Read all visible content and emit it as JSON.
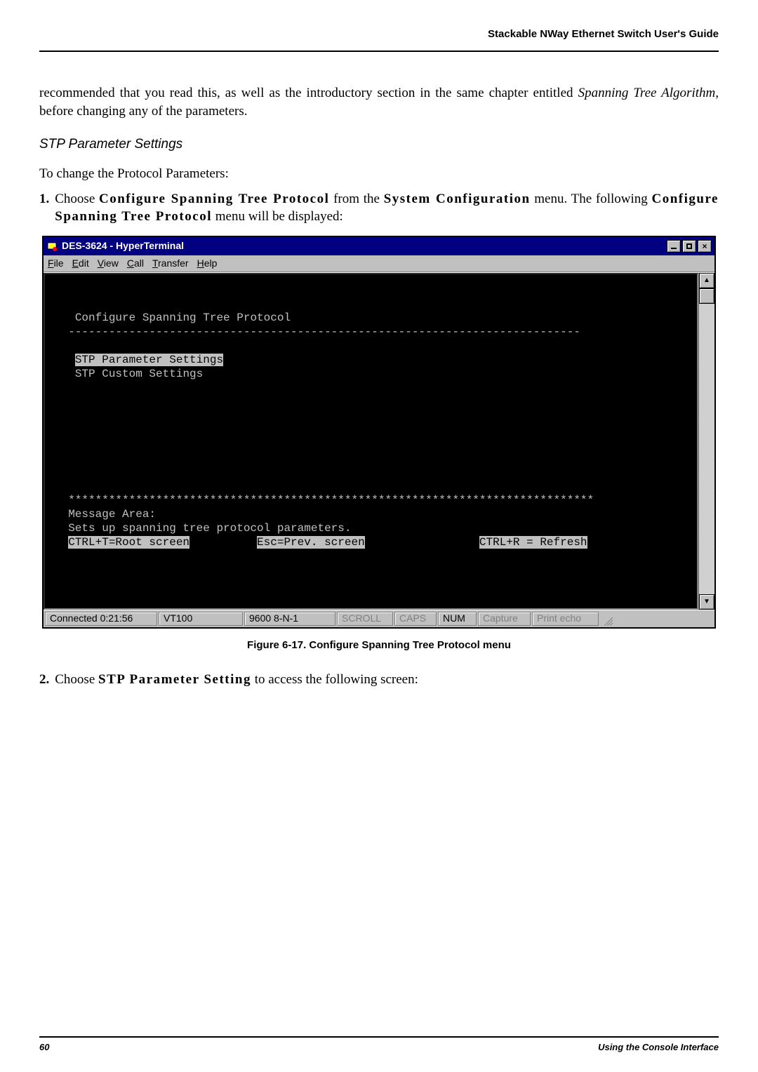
{
  "header": {
    "running_head": "Stackable NWay Ethernet Switch User's Guide"
  },
  "body": {
    "para_intro": "recommended that you read this, as well as the introductory section in the same chapter entitled ",
    "para_intro_em": "Spanning Tree Algorithm,",
    "para_intro_tail": " before changing any of the parameters.",
    "subheading": "STP Parameter Settings",
    "para_change": "To change the Protocol Parameters:",
    "step1_num": "1.",
    "step1_a": "Choose ",
    "step1_b": "Configure Spanning Tree Protocol",
    "step1_c": " from the ",
    "step1_d": "System Configuration",
    "step1_e": " menu. The following ",
    "step1_f": "Configure Spanning Tree Protocol",
    "step1_g": " menu will be displayed:",
    "step2_num": "2.",
    "step2_a": "Choose ",
    "step2_b": "STP Parameter Setting",
    "step2_c": " to access the following screen:",
    "caption": "Figure 6-17.  Configure Spanning Tree Protocol menu"
  },
  "window": {
    "title": "DES-3624 - HyperTerminal",
    "menus": {
      "file": "File",
      "edit": "Edit",
      "view": "View",
      "call": "Call",
      "transfer": "Transfer",
      "help": "Help"
    },
    "terminal": {
      "heading": "Configure Spanning Tree Protocol",
      "divider": "----------------------------------------------------------------------------",
      "item_selected": "STP Parameter Settings",
      "item2": "STP Custom Settings",
      "stars": "******************************************************************************",
      "msg_label": "Message Area:",
      "msg_text": "Sets up spanning tree protocol parameters.",
      "hint_root": "CTRL+T=Root screen",
      "hint_prev": "Esc=Prev. screen",
      "hint_refresh": "CTRL+R = Refresh"
    },
    "status": {
      "conn": "Connected 0:21:56",
      "emu": "VT100",
      "line": "9600 8-N-1",
      "scroll": "SCROLL",
      "caps": "CAPS",
      "num": "NUM",
      "capture": "Capture",
      "echo": "Print echo"
    }
  },
  "footer": {
    "page": "60",
    "section": "Using the Console Interface"
  }
}
